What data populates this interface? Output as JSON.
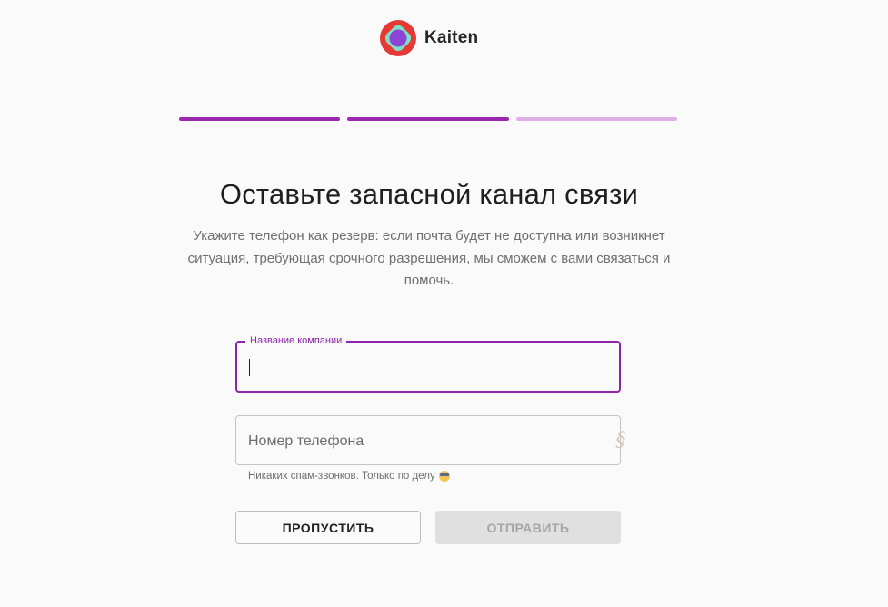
{
  "brand": {
    "name": "Kaiten",
    "logo_icon": "kaiten-logo-icon"
  },
  "progress": {
    "steps_total": 3,
    "steps_completed": 2,
    "colors": {
      "done": "#9c27b0",
      "pending": "#dfaee6"
    }
  },
  "heading": {
    "title": "Оставьте запасной канал связи",
    "subtitle": "Укажите телефон как резерв: если почта будет не доступна или возникнет ситуация, требующая срочного разрешения, мы сможем с вами связаться и помочь."
  },
  "form": {
    "company": {
      "label": "Название компании",
      "value": ""
    },
    "phone": {
      "placeholder": "Номер телефона",
      "value": "",
      "icon": "autofill-key-icon",
      "helper": "Никаких спам-звонков. Только по делу",
      "helper_icon": "sunglasses-emoji-icon"
    }
  },
  "actions": {
    "skip_label": "Пропустить",
    "submit_label": "Отправить"
  },
  "colors": {
    "accent": "#8e24aa",
    "background": "#fafafa"
  }
}
